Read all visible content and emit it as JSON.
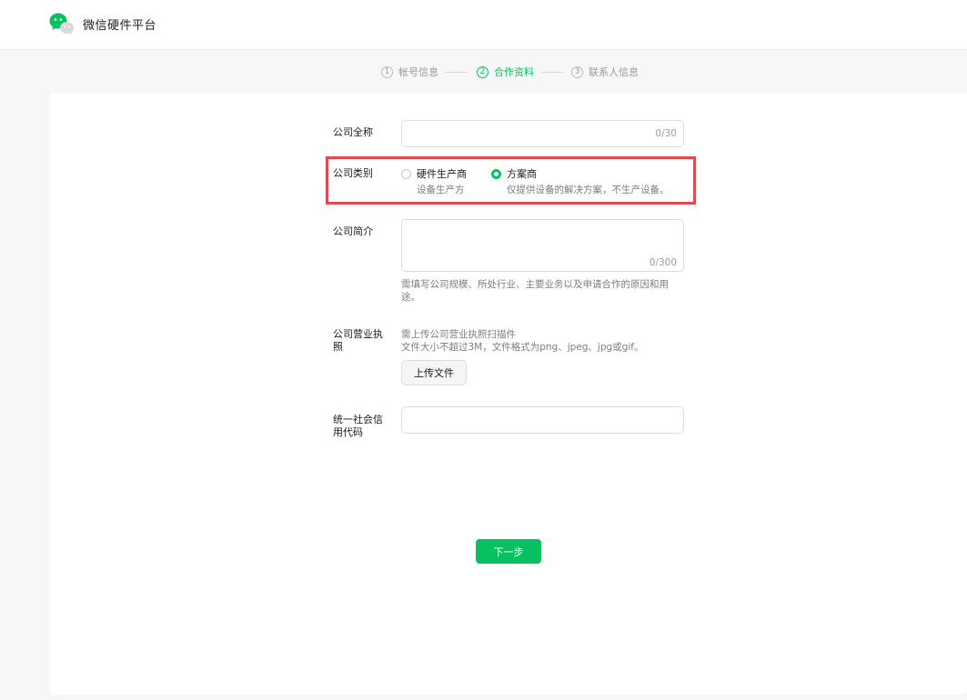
{
  "header": {
    "brand": "微信硬件平台",
    "logo_icon": "wechat-logo-icon",
    "brand_color": "#07c160"
  },
  "steps": [
    {
      "num": "1",
      "label": "帐号信息",
      "active": false
    },
    {
      "num": "2",
      "label": "合作资料",
      "active": true
    },
    {
      "num": "3",
      "label": "联系人信息",
      "active": false
    }
  ],
  "form": {
    "company_name": {
      "label": "公司全称",
      "value": "",
      "counter": "0/30"
    },
    "company_type": {
      "label": "公司类别",
      "options": [
        {
          "title": "硬件生产商",
          "desc": "设备生产方",
          "selected": false
        },
        {
          "title": "方案商",
          "desc": "仅提供设备的解决方案，不生产设备。",
          "selected": true
        }
      ]
    },
    "company_intro": {
      "label": "公司简介",
      "value": "",
      "counter": "0/300",
      "tip": "需填写公司规模、所处行业、主要业务以及申请合作的原因和用途。"
    },
    "license": {
      "label": "公司营业执照",
      "tip1": "需上传公司营业执照扫描件",
      "tip2": "文件大小不超过3M，文件格式为png、jpeg、jpg或gif。",
      "upload_label": "上传文件"
    },
    "credit_code": {
      "label": "统一社会信用代码",
      "value": ""
    }
  },
  "actions": {
    "next_label": "下一步"
  },
  "colors": {
    "accent": "#07c160",
    "highlight": "#e5484d"
  }
}
